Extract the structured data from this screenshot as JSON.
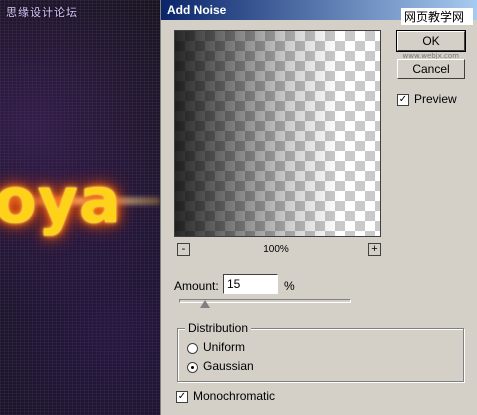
{
  "background": {
    "watermark": "思缘设计论坛",
    "text_art": "oya"
  },
  "dialog": {
    "title": "Add Noise",
    "site_label": "网页教学网",
    "site_label_sub": "www.webjx.com",
    "ok_label": "OK",
    "cancel_label": "Cancel",
    "preview_label": "Preview",
    "preview_checked": true,
    "preview_pane": {
      "zoom_level": "100%",
      "zoom_out": "-",
      "zoom_in": "+"
    },
    "amount": {
      "label": "Amount:",
      "value": "15",
      "unit": "%",
      "slider_fraction": 0.15
    },
    "distribution": {
      "label": "Distribution",
      "options": [
        {
          "label": "Uniform",
          "selected": false
        },
        {
          "label": "Gaussian",
          "selected": true
        }
      ]
    },
    "monochromatic": {
      "label": "Monochromatic",
      "checked": true
    }
  },
  "colors": {
    "titlebar": "#0a246a",
    "dialog_bg": "#d4d0c8",
    "glow": "#ffd21a"
  }
}
